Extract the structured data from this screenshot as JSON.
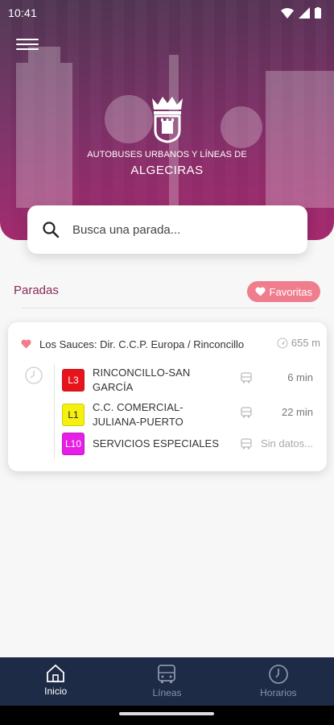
{
  "status_bar": {
    "time": "10:41"
  },
  "header": {
    "brand_line1": "AUTOBUSES URBANOS Y LÍNEAS DE",
    "brand_line2": "ALGECIRAS"
  },
  "search": {
    "placeholder": "Busca una parada..."
  },
  "section": {
    "title": "Paradas",
    "favorites_label": "Favoritas"
  },
  "stop": {
    "name": "Los Sauces: Dir. C.C.P. Europa / Rinconcillo",
    "distance": "655 m",
    "routes": [
      {
        "code": "L3",
        "name": "RINCONCILLO-SAN GARCÍA",
        "eta": "6 min",
        "color": "#e8141c"
      },
      {
        "code": "L1",
        "name": "C.C. COMERCIAL-JULIANA-PUERTO",
        "eta": "22 min",
        "color": "#f5f00f"
      },
      {
        "code": "L10",
        "name": "SERVICIOS ESPECIALES",
        "eta": "Sin datos...",
        "color": "#e61ee6"
      }
    ]
  },
  "nav": [
    {
      "label": "Inicio",
      "icon": "home-icon",
      "active": true
    },
    {
      "label": "Líneas",
      "icon": "bus-icon",
      "active": false
    },
    {
      "label": "Horarios",
      "icon": "clock-icon",
      "active": false
    }
  ],
  "colors": {
    "brand": "#8b2a55",
    "favorites": "#f07d8d",
    "nav_bg": "#1d2b47"
  }
}
